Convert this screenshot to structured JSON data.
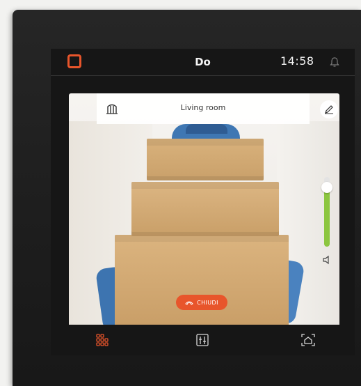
{
  "status_bar": {
    "day": "Do",
    "time": "14:58",
    "accent_color": "#e8552b"
  },
  "room_header": {
    "title": "Living room",
    "left_icon": "gate-icon",
    "right_icon": "edit-pencil-icon"
  },
  "volume": {
    "level_fraction": 0.85,
    "fill_color": "#8cc63f",
    "icon": "speaker-icon"
  },
  "call_action": {
    "label": "CHIUDI",
    "icon": "hangup-icon",
    "color": "#e8552b"
  },
  "nav": {
    "items": [
      {
        "icon": "rooms-grid-icon",
        "active": true
      },
      {
        "icon": "control-panel-icon",
        "active": false
      },
      {
        "icon": "camera-home-icon",
        "active": false
      }
    ]
  }
}
